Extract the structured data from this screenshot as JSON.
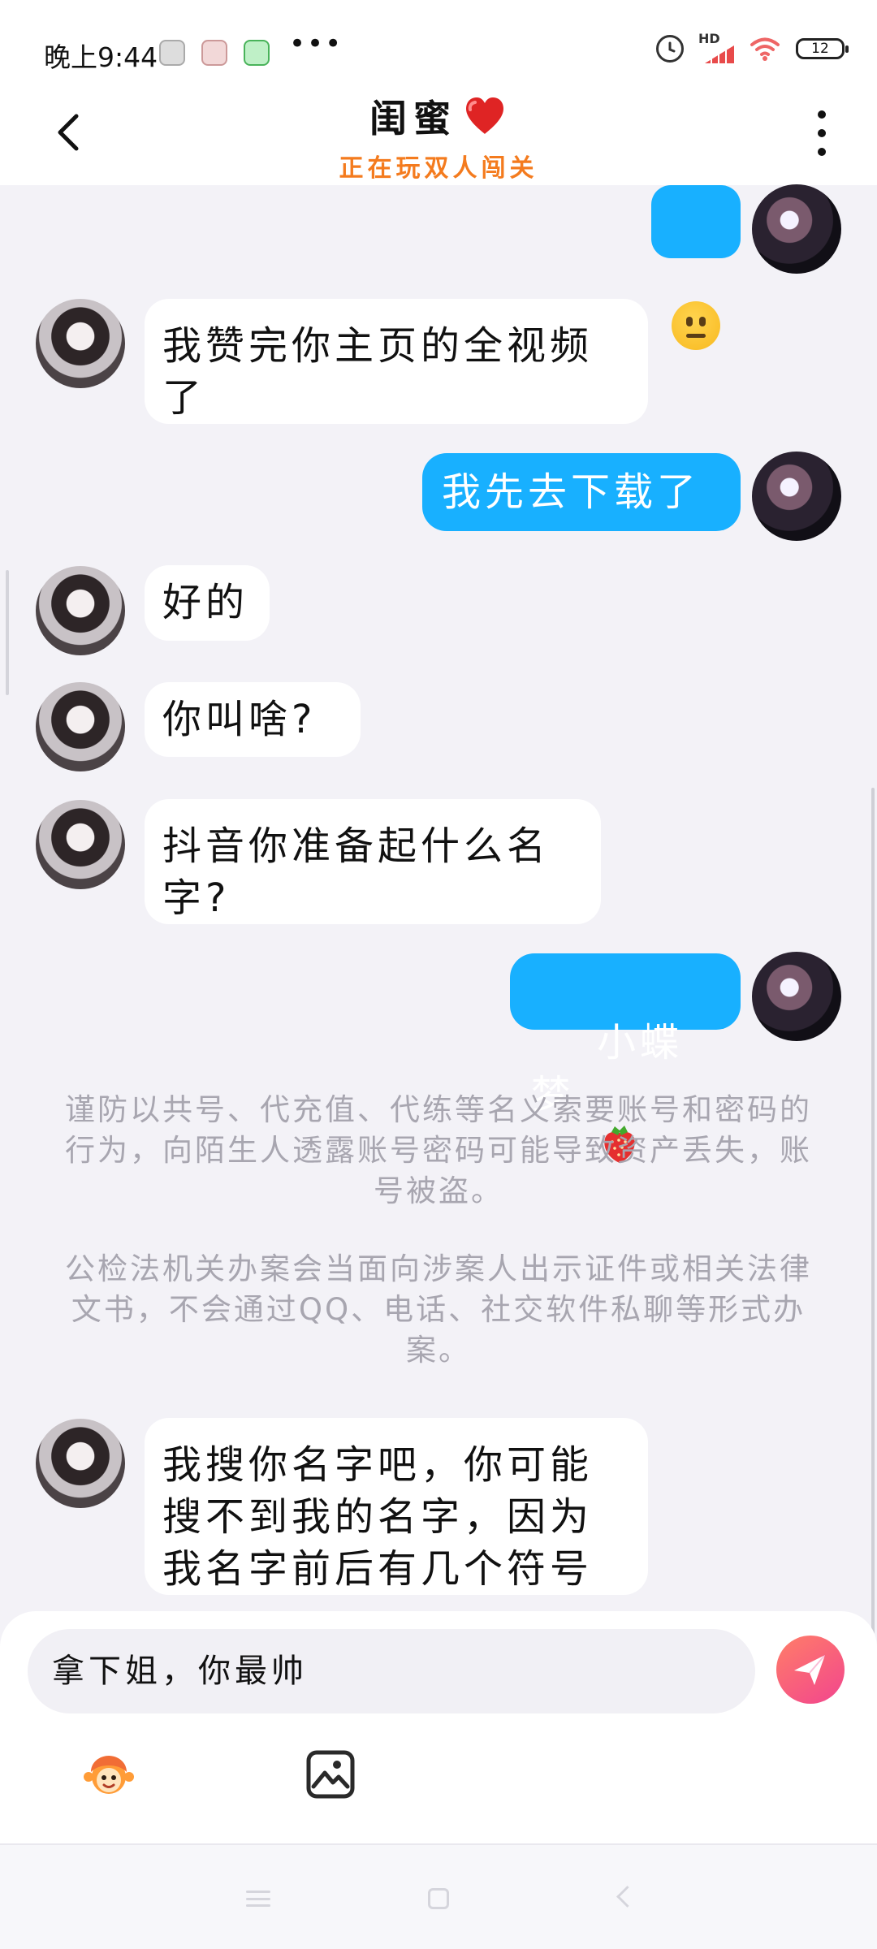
{
  "status_bar": {
    "time": "晚上9:44",
    "more_text": "•••",
    "hd_label": "HD",
    "battery_level": "12"
  },
  "header": {
    "title": "闺蜜",
    "subtitle": "正在玩双人闯关"
  },
  "messages": [
    {
      "side": "right",
      "emoji": "neutral-face"
    },
    {
      "side": "left",
      "text": "我赞完你主页的全视频\n了"
    },
    {
      "side": "right",
      "text": "我先去下载了"
    },
    {
      "side": "left",
      "text": "好的"
    },
    {
      "side": "left",
      "text": "你叫啥?"
    },
    {
      "side": "left",
      "text": "抖音你准备起什么名\n字?"
    },
    {
      "side": "right",
      "text": "小蝶梦",
      "emoji": "strawberry"
    },
    {
      "side": "left",
      "text": "我搜你名字吧，你可能\n搜不到我的名字，因为\n我名字前后有几个符号"
    }
  ],
  "notices": [
    "谨防以共号、代充值、代练等名义索要账号和密码的行为，向陌生人透露账号密码可能导致资产丢失，账号被盗。",
    "公检法机关办案会当面向涉案人出示证件或相关法律文书，不会通过QQ、电话、社交软件私聊等形式办案。"
  ],
  "input": {
    "value": "拿下姐，你最帅"
  },
  "icons": {
    "send": "send-icon",
    "emoji_tool": "emoji-tool-icon",
    "image_tool": "image-icon",
    "back": "back-icon",
    "more": "more-icon"
  },
  "colors": {
    "accent_blue": "#18b0ff",
    "subtitle_orange": "#f47b1e",
    "send_gradient_start": "#ff7e68",
    "send_gradient_end": "#f2458e"
  }
}
